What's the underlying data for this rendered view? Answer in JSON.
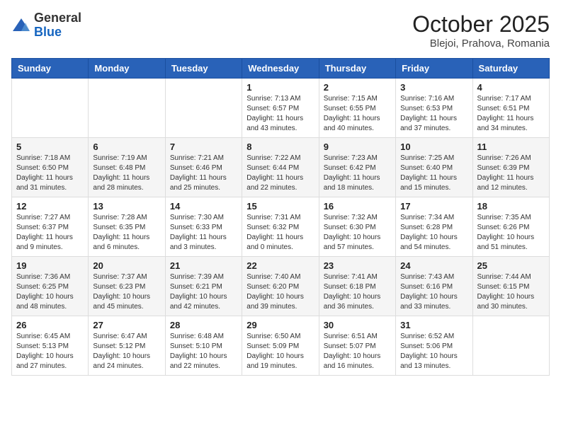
{
  "logo": {
    "general": "General",
    "blue": "Blue"
  },
  "title": "October 2025",
  "location": "Blejoi, Prahova, Romania",
  "days_of_week": [
    "Sunday",
    "Monday",
    "Tuesday",
    "Wednesday",
    "Thursday",
    "Friday",
    "Saturday"
  ],
  "weeks": [
    [
      {
        "day": "",
        "info": ""
      },
      {
        "day": "",
        "info": ""
      },
      {
        "day": "",
        "info": ""
      },
      {
        "day": "1",
        "info": "Sunrise: 7:13 AM\nSunset: 6:57 PM\nDaylight: 11 hours\nand 43 minutes."
      },
      {
        "day": "2",
        "info": "Sunrise: 7:15 AM\nSunset: 6:55 PM\nDaylight: 11 hours\nand 40 minutes."
      },
      {
        "day": "3",
        "info": "Sunrise: 7:16 AM\nSunset: 6:53 PM\nDaylight: 11 hours\nand 37 minutes."
      },
      {
        "day": "4",
        "info": "Sunrise: 7:17 AM\nSunset: 6:51 PM\nDaylight: 11 hours\nand 34 minutes."
      }
    ],
    [
      {
        "day": "5",
        "info": "Sunrise: 7:18 AM\nSunset: 6:50 PM\nDaylight: 11 hours\nand 31 minutes."
      },
      {
        "day": "6",
        "info": "Sunrise: 7:19 AM\nSunset: 6:48 PM\nDaylight: 11 hours\nand 28 minutes."
      },
      {
        "day": "7",
        "info": "Sunrise: 7:21 AM\nSunset: 6:46 PM\nDaylight: 11 hours\nand 25 minutes."
      },
      {
        "day": "8",
        "info": "Sunrise: 7:22 AM\nSunset: 6:44 PM\nDaylight: 11 hours\nand 22 minutes."
      },
      {
        "day": "9",
        "info": "Sunrise: 7:23 AM\nSunset: 6:42 PM\nDaylight: 11 hours\nand 18 minutes."
      },
      {
        "day": "10",
        "info": "Sunrise: 7:25 AM\nSunset: 6:40 PM\nDaylight: 11 hours\nand 15 minutes."
      },
      {
        "day": "11",
        "info": "Sunrise: 7:26 AM\nSunset: 6:39 PM\nDaylight: 11 hours\nand 12 minutes."
      }
    ],
    [
      {
        "day": "12",
        "info": "Sunrise: 7:27 AM\nSunset: 6:37 PM\nDaylight: 11 hours\nand 9 minutes."
      },
      {
        "day": "13",
        "info": "Sunrise: 7:28 AM\nSunset: 6:35 PM\nDaylight: 11 hours\nand 6 minutes."
      },
      {
        "day": "14",
        "info": "Sunrise: 7:30 AM\nSunset: 6:33 PM\nDaylight: 11 hours\nand 3 minutes."
      },
      {
        "day": "15",
        "info": "Sunrise: 7:31 AM\nSunset: 6:32 PM\nDaylight: 11 hours\nand 0 minutes."
      },
      {
        "day": "16",
        "info": "Sunrise: 7:32 AM\nSunset: 6:30 PM\nDaylight: 10 hours\nand 57 minutes."
      },
      {
        "day": "17",
        "info": "Sunrise: 7:34 AM\nSunset: 6:28 PM\nDaylight: 10 hours\nand 54 minutes."
      },
      {
        "day": "18",
        "info": "Sunrise: 7:35 AM\nSunset: 6:26 PM\nDaylight: 10 hours\nand 51 minutes."
      }
    ],
    [
      {
        "day": "19",
        "info": "Sunrise: 7:36 AM\nSunset: 6:25 PM\nDaylight: 10 hours\nand 48 minutes."
      },
      {
        "day": "20",
        "info": "Sunrise: 7:37 AM\nSunset: 6:23 PM\nDaylight: 10 hours\nand 45 minutes."
      },
      {
        "day": "21",
        "info": "Sunrise: 7:39 AM\nSunset: 6:21 PM\nDaylight: 10 hours\nand 42 minutes."
      },
      {
        "day": "22",
        "info": "Sunrise: 7:40 AM\nSunset: 6:20 PM\nDaylight: 10 hours\nand 39 minutes."
      },
      {
        "day": "23",
        "info": "Sunrise: 7:41 AM\nSunset: 6:18 PM\nDaylight: 10 hours\nand 36 minutes."
      },
      {
        "day": "24",
        "info": "Sunrise: 7:43 AM\nSunset: 6:16 PM\nDaylight: 10 hours\nand 33 minutes."
      },
      {
        "day": "25",
        "info": "Sunrise: 7:44 AM\nSunset: 6:15 PM\nDaylight: 10 hours\nand 30 minutes."
      }
    ],
    [
      {
        "day": "26",
        "info": "Sunrise: 6:45 AM\nSunset: 5:13 PM\nDaylight: 10 hours\nand 27 minutes."
      },
      {
        "day": "27",
        "info": "Sunrise: 6:47 AM\nSunset: 5:12 PM\nDaylight: 10 hours\nand 24 minutes."
      },
      {
        "day": "28",
        "info": "Sunrise: 6:48 AM\nSunset: 5:10 PM\nDaylight: 10 hours\nand 22 minutes."
      },
      {
        "day": "29",
        "info": "Sunrise: 6:50 AM\nSunset: 5:09 PM\nDaylight: 10 hours\nand 19 minutes."
      },
      {
        "day": "30",
        "info": "Sunrise: 6:51 AM\nSunset: 5:07 PM\nDaylight: 10 hours\nand 16 minutes."
      },
      {
        "day": "31",
        "info": "Sunrise: 6:52 AM\nSunset: 5:06 PM\nDaylight: 10 hours\nand 13 minutes."
      },
      {
        "day": "",
        "info": ""
      }
    ]
  ]
}
